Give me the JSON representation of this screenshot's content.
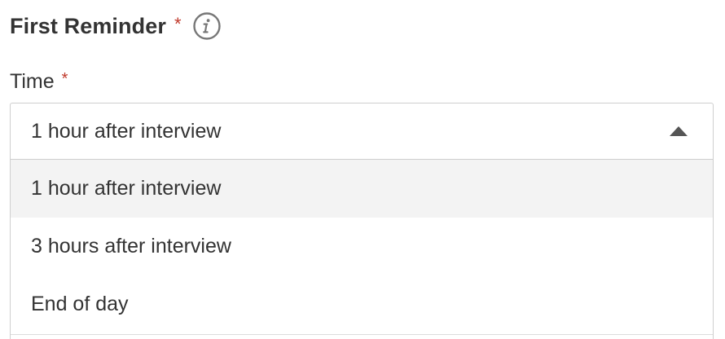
{
  "reminder": {
    "title": "First Reminder",
    "required_mark": "*",
    "info_icon": "info-icon"
  },
  "time_field": {
    "label": "Time",
    "required_mark": "*",
    "selected_value": "1 hour after interview",
    "expanded": true,
    "caret_icon": "caret-up-icon",
    "options": [
      {
        "label": "1 hour after interview",
        "highlighted": true
      },
      {
        "label": "3 hours after interview",
        "highlighted": false
      },
      {
        "label": "End of day",
        "highlighted": false
      }
    ]
  },
  "colors": {
    "text": "#333333",
    "required": "#c0392b",
    "border": "#cfcfcf",
    "highlight_bg": "#f3f3f3",
    "icon": "#777777"
  }
}
